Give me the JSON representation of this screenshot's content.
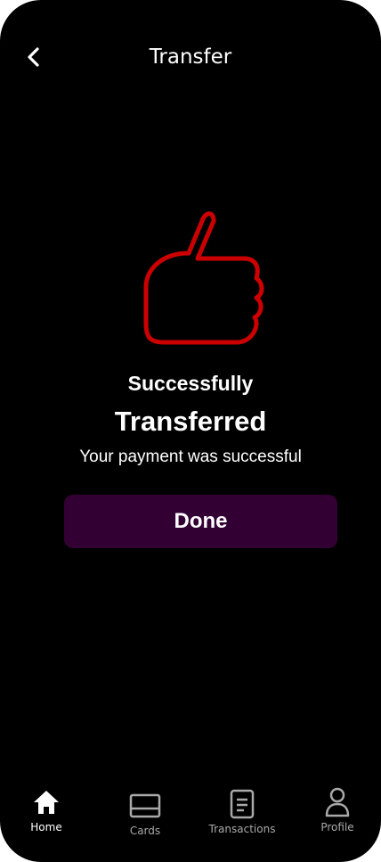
{
  "header": {
    "title": "Transfer",
    "back_icon": "chevron-left-icon"
  },
  "status": {
    "icon": "thumbs-up-icon",
    "icon_color": "#cc0000",
    "headline": "Successfully",
    "headline_2": "Transferred",
    "message": "Your payment was successful"
  },
  "actions": {
    "done_label": "Done",
    "done_color": "#330033"
  },
  "bottom_nav": {
    "active": "Home",
    "items": [
      {
        "label": "Home",
        "icon": "home-icon"
      },
      {
        "label": "Cards",
        "icon": "card-icon"
      },
      {
        "label": "Transactions",
        "icon": "document-icon"
      },
      {
        "label": "Profile",
        "icon": "user-icon"
      }
    ]
  }
}
